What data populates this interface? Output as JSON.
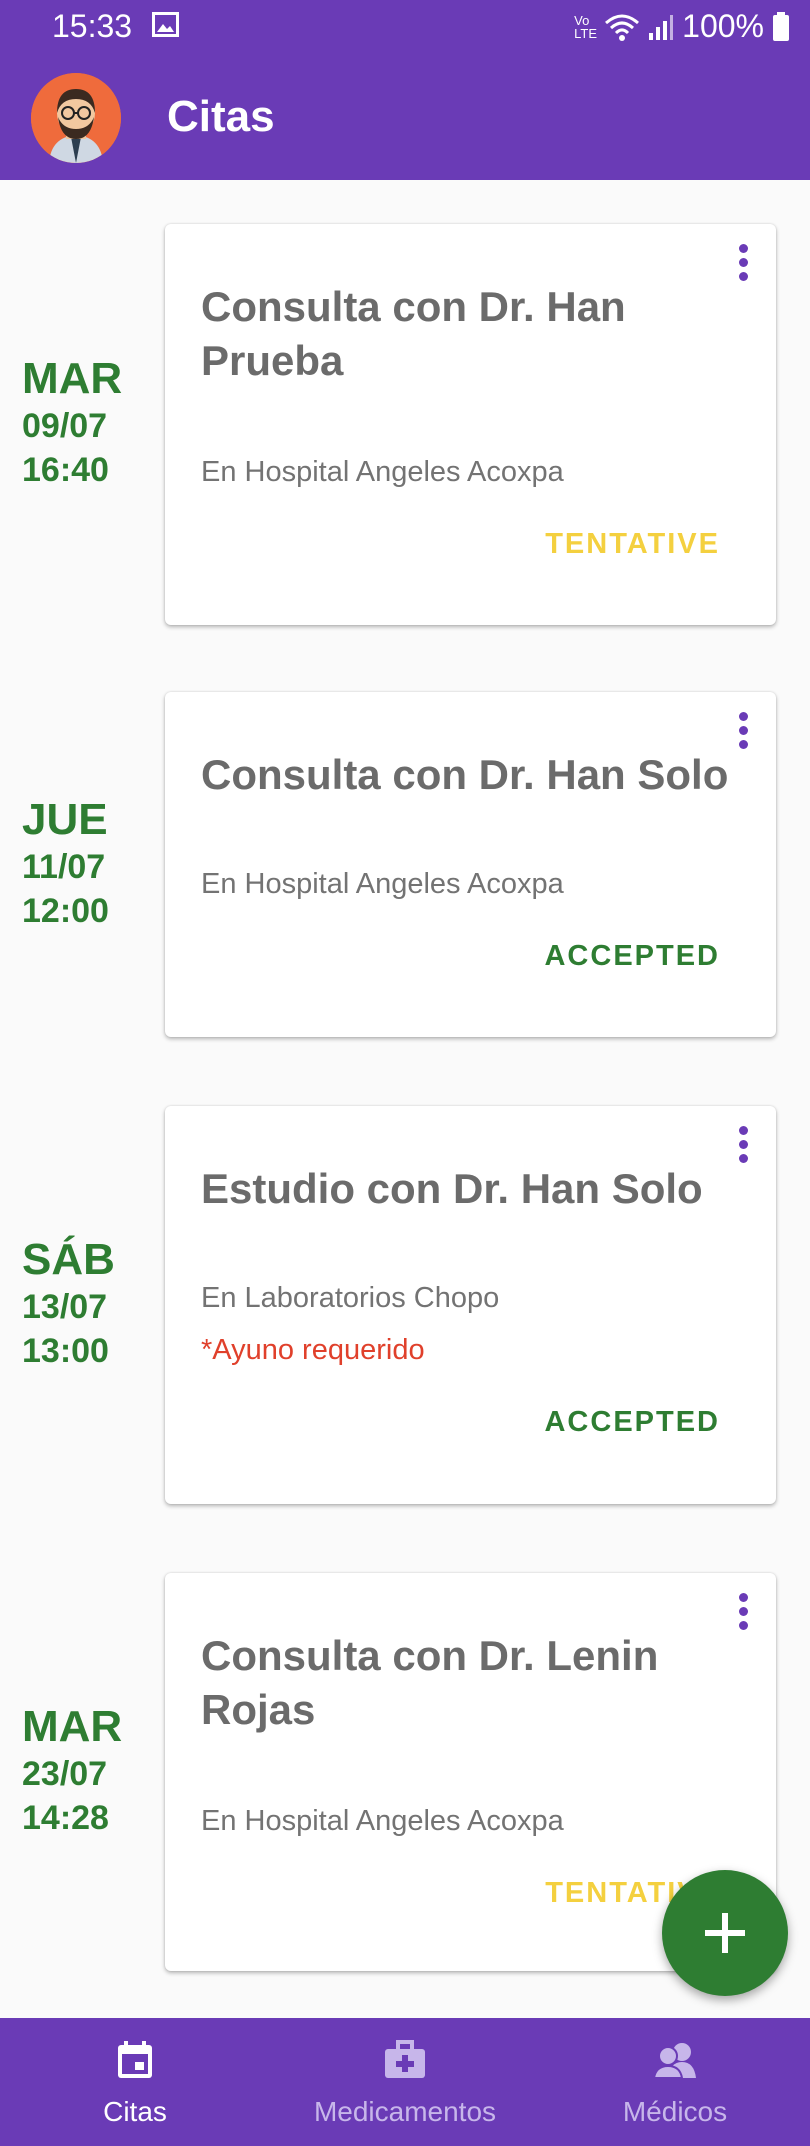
{
  "status_bar": {
    "time": "15:33",
    "network": "Vo LTE",
    "battery": "100%"
  },
  "app_bar": {
    "title": "Citas"
  },
  "appointments": [
    {
      "day": "MAR",
      "date": "09/07",
      "time": "16:40",
      "title": "Consulta con Dr. Han Prueba",
      "location": "En Hospital Angeles Acoxpa",
      "note": "",
      "status": "TENTATIVE"
    },
    {
      "day": "JUE",
      "date": "11/07",
      "time": "12:00",
      "title": "Consulta con Dr. Han Solo",
      "location": "En Hospital Angeles Acoxpa",
      "note": "",
      "status": "ACCEPTED"
    },
    {
      "day": "SÁB",
      "date": "13/07",
      "time": "13:00",
      "title": "Estudio con Dr. Han Solo",
      "location": "En Laboratorios Chopo",
      "note": "*Ayuno requerido",
      "status": "ACCEPTED"
    },
    {
      "day": "MAR",
      "date": "23/07",
      "time": "14:28",
      "title": "Consulta con Dr. Lenin Rojas",
      "location": "En Hospital Angeles Acoxpa",
      "note": "",
      "status": "TENTATIVE"
    }
  ],
  "bottom_nav": {
    "items": [
      {
        "label": "Citas",
        "icon": "calendar-icon",
        "active": true
      },
      {
        "label": "Medicamentos",
        "icon": "medkit-icon",
        "active": false
      },
      {
        "label": "Médicos",
        "icon": "doctors-icon",
        "active": false
      }
    ]
  },
  "fab": {
    "icon": "plus-icon"
  },
  "colors": {
    "primary": "#6a3bb6",
    "accent_green": "#2e7d32",
    "tentative": "#f4d03f",
    "note_red": "#e0402b"
  }
}
